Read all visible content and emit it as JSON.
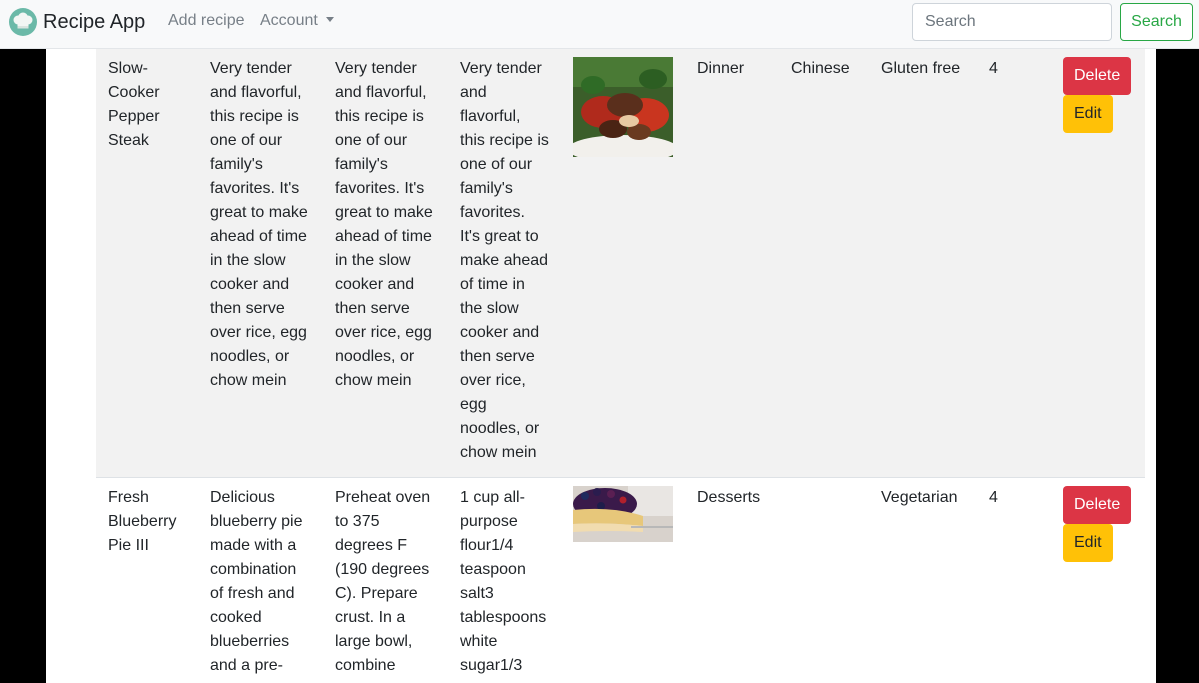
{
  "navbar": {
    "brand": "Recipe App",
    "add_recipe": "Add recipe",
    "account": "Account",
    "search_placeholder": "Search",
    "search_button": "Search"
  },
  "recipes": [
    {
      "name": "Slow-Cooker Pepper Steak",
      "description": "Very tender and flavorful, this recipe is one of our family's favorites. It's great to make ahead of time in the slow cooker and then serve over rice, egg noodles, or chow mein",
      "directions": "Very tender and flavorful, this recipe is one of our family's favorites. It's great to make ahead of time in the slow cooker and then serve over rice, egg noodles, or chow mein",
      "ingredients": "Very tender and flavorful, this recipe is one of our family's favorites. It's great to make ahead of time in the slow cooker and then serve over rice, egg noodles, or chow mein",
      "image_alt": "pepper steak photo",
      "category": "Dinner",
      "cuisine": "Chinese",
      "diet": "Gluten free",
      "rating": "4",
      "delete_label": "Delete",
      "edit_label": "Edit"
    },
    {
      "name": "Fresh Blueberry Pie III",
      "description": "Delicious blueberry pie made with a combination of fresh and cooked blueberries and a pre-",
      "directions": "Preheat oven to 375 degrees F (190 degrees C). Prepare crust. In a large bowl, combine",
      "ingredients": "1 cup all-purpose flour1/4 teaspoon salt3 tablespoons white sugar1/3",
      "image_alt": "blueberry pie photo",
      "category": "Desserts",
      "cuisine": "",
      "diet": "Vegetarian",
      "rating": "4",
      "delete_label": "Delete",
      "edit_label": "Edit"
    }
  ],
  "colors": {
    "delete": "#dc3545",
    "edit": "#ffc107",
    "search_outline": "#28a745",
    "navbar_bg": "#f8f9fa"
  }
}
